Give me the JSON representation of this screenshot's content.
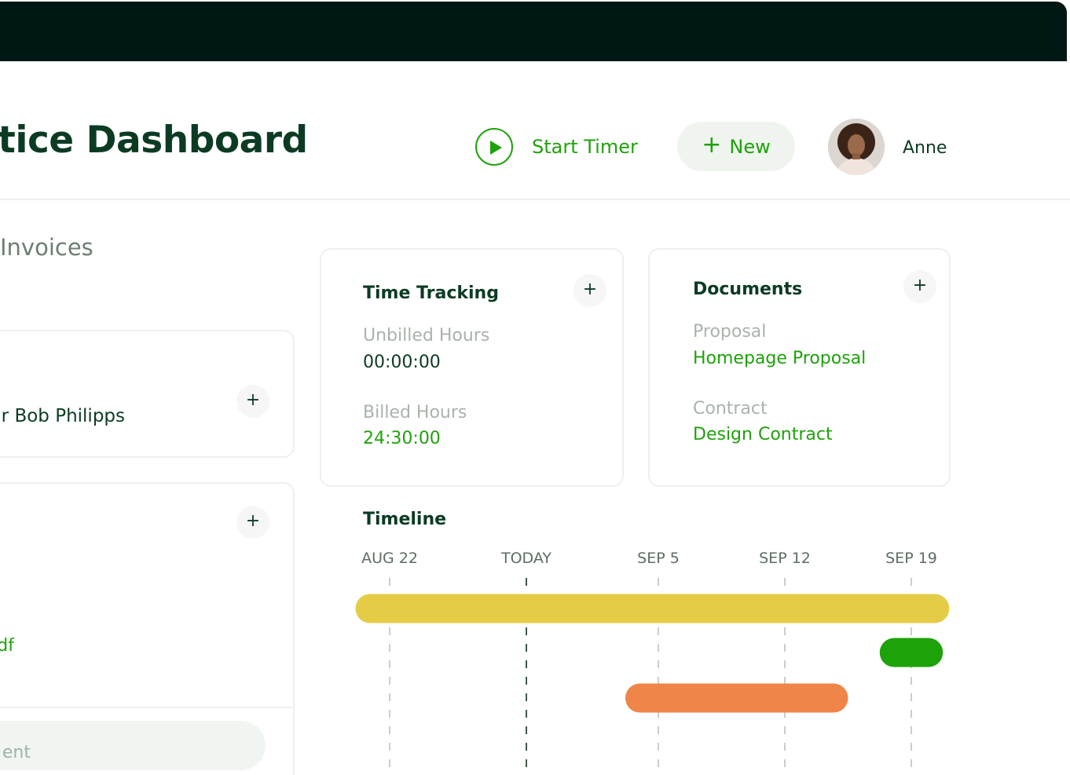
{
  "header": {
    "title": "ctice Dashboard",
    "start_timer_label": "Start Timer",
    "new_label": "New",
    "new_icon": "plus-icon",
    "play_icon": "play-icon",
    "user_name": "Anne"
  },
  "invoices": {
    "heading": "Invoices",
    "client_text": "r Bob Philipps",
    "file_link_text": "df",
    "comment_placeholder": "ent"
  },
  "time_tracking": {
    "title": "Time Tracking",
    "unbilled_label": "Unbilled Hours",
    "unbilled_value": "00:00:00",
    "billed_label": "Billed Hours",
    "billed_value": "24:30:00"
  },
  "documents": {
    "title": "Documents",
    "proposal_label": "Proposal",
    "proposal_link": "Homepage Proposal",
    "contract_label": "Contract",
    "contract_link": "Design Contract"
  },
  "timeline": {
    "title": "Timeline",
    "ticks": [
      "AUG 22",
      "TODAY",
      "SEP 5",
      "SEP 12",
      "SEP 19"
    ],
    "today_tick_index": 1,
    "bars": [
      {
        "start_tick": -0.25,
        "end_tick": 4.3,
        "color": "#e4cc47"
      },
      {
        "start_tick": 3.75,
        "end_tick": 4.25,
        "color": "#1ea20a"
      },
      {
        "start_tick": 1.75,
        "end_tick": 3.5,
        "color": "#ef8548"
      }
    ]
  },
  "colors": {
    "accent": "#1ea20a",
    "dark_text": "#0c3b23",
    "topbar": "#001813"
  }
}
